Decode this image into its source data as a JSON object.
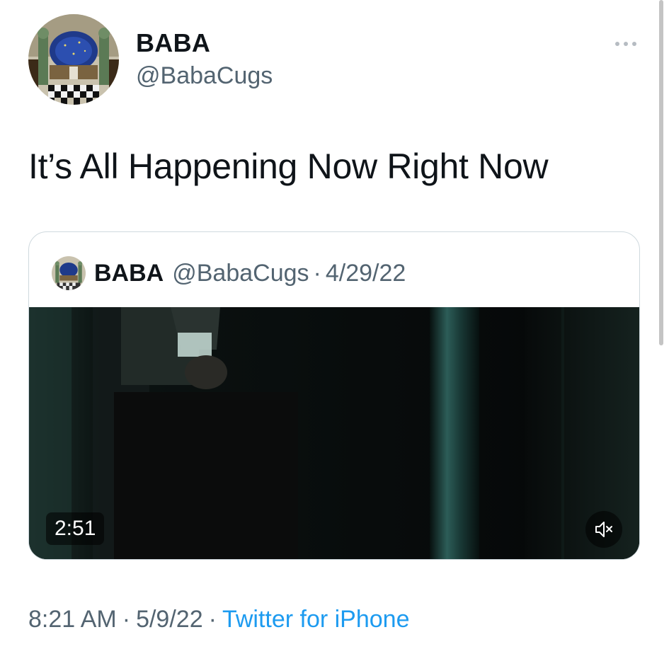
{
  "author": {
    "display_name": "BABA",
    "handle": "@BabaCugs"
  },
  "tweet": {
    "text": "It’s All Happening Now Right Now"
  },
  "more_icon": "ellipsis-icon",
  "quote": {
    "display_name": "BABA",
    "handle": "@BabaCugs",
    "separator": "·",
    "date": "4/29/22",
    "video": {
      "duration": "2:51",
      "mute_icon": "speaker-muted-icon"
    }
  },
  "meta": {
    "time": "8:21 AM",
    "separator": "·",
    "date": "5/9/22",
    "source": "Twitter for iPhone"
  },
  "colors": {
    "link": "#1d9bf0",
    "secondary_text": "#536471",
    "border": "#cfd9de"
  }
}
